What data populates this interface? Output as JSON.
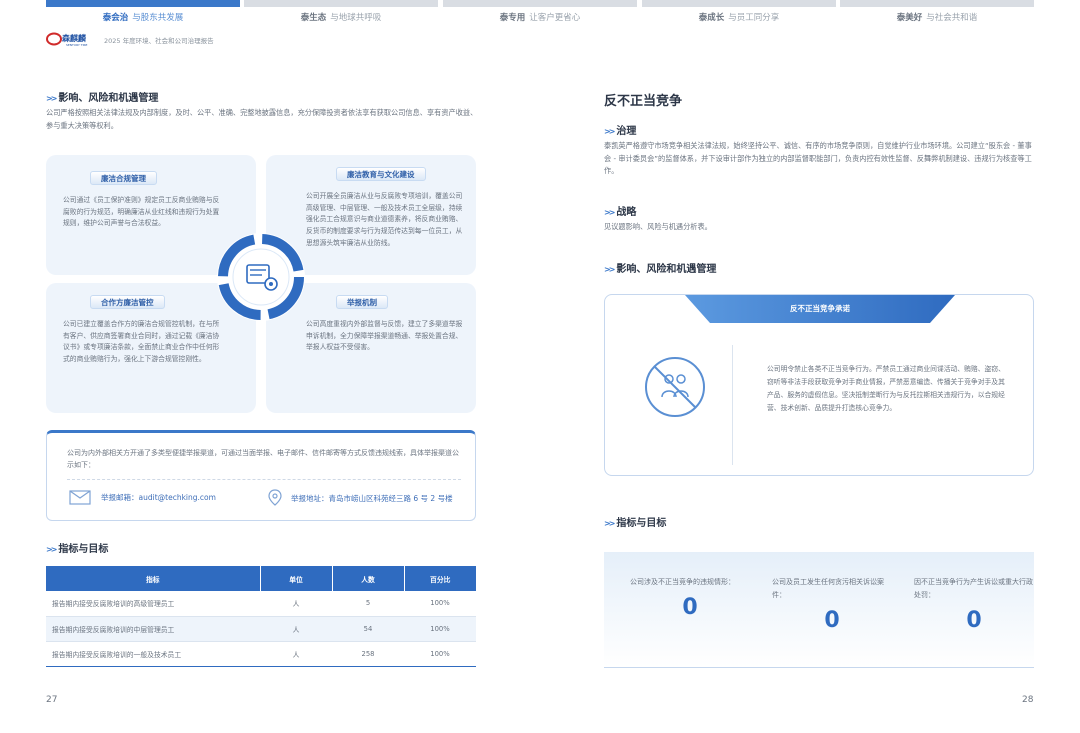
{
  "tabs": [
    {
      "key": "泰会治",
      "text": "与股东共发展",
      "active": true
    },
    {
      "key": "泰生态",
      "text": "与地球共呼吸",
      "active": false
    },
    {
      "key": "泰专用",
      "text": "让客户更省心",
      "active": false
    },
    {
      "key": "泰成长",
      "text": "与员工同分享",
      "active": false
    },
    {
      "key": "泰美好",
      "text": "与社会共和谐",
      "active": false
    }
  ],
  "brand": {
    "logo_text": "森麒麟轮胎",
    "logo_sub": "SENTURY TIRE",
    "report_title": "2025 年度环境、社会和公司治理报告"
  },
  "left": {
    "impact_heading": "影响、风险和机遇管理",
    "impact_text": "公司严格按照相关法律法规及内部制度，及时、公平、准确、完整地披露信息，充分保障投资者依法享有获取公司信息、享有资产收益、参与重大决策等权利。",
    "quadrants": [
      {
        "title": "廉洁合规管理",
        "text": "公司通过《员工保护准则》规定员工反商业贿赂与反腐败的行为规范，明确廉洁从业红线和违规行为处置规则，维护公司声誉与合法权益。"
      },
      {
        "title": "廉洁教育与文化建设",
        "text": "公司开展全员廉洁从业与反腐败专项培训，覆盖公司高级管理、中层管理、一般及技术员工全层级，持续强化员工合规意识与商业道德素养，将反商业贿赂、反货币的制度要求与行为规范传达到每一位员工，从思想源头筑牢廉洁从业防线。"
      },
      {
        "title": "合作方廉洁管控",
        "text": "公司已建立覆盖合作方的廉洁合规管控机制，在与所有客户、供应商签署商业合同时，通过记载《廉洁协议书》或专项廉洁条款，全面禁止商业合作中任何形式的商业贿赂行为，强化上下游合规管控刚性。"
      },
      {
        "title": "举报机制",
        "text": "公司高度重视内外部监督与反馈，建立了多渠道举报申诉机制，全力保障举报渠道畅通、举报处置合规、举报人权益不受侵害。"
      }
    ],
    "contact": {
      "text": "公司为内外部相关方开通了多类型便捷举报渠道，可通过当面举报、电子邮件、信件邮寄等方式反馈违规线索，具体举报渠道公示如下：",
      "email_label": "举报邮箱：audit@techking.com",
      "address_label": "举报地址：青岛市崂山区科苑经三路 6 号 2 号楼"
    },
    "metrics_heading": "指标与目标",
    "table": {
      "headers": [
        "指标",
        "单位",
        "人数",
        "百分比"
      ],
      "rows": [
        [
          "报告期内接受反腐败培训的高级管理员工",
          "人",
          "5",
          "100%"
        ],
        [
          "报告期内接受反腐败培训的中层管理员工",
          "人",
          "54",
          "100%"
        ],
        [
          "报告期内接受反腐败培训的一般及技术员工",
          "人",
          "258",
          "100%"
        ]
      ]
    },
    "page_number": "27"
  },
  "right": {
    "title": "反不正当竞争",
    "governance_heading": "治理",
    "governance_text": "泰凯英严格遵守市场竞争相关法律法规，始终坚持公平、诚信、有序的市场竞争原则，自觉维护行业市场环境。公司建立“股东会 - 董事会 - 审计委员会”的监督体系，并下设审计部作为独立的内部监督职能部门，负责内控有效性监督、反舞弊机制建设、违规行为核查等工作。",
    "strategy_heading": "战略",
    "strategy_text": "见议题影响、风险与机遇分析表。",
    "impact_heading": "影响、风险和机遇管理",
    "commitment": {
      "title": "反不正当竞争承诺",
      "text": "公司明令禁止各类不正当竞争行为。严禁员工通过商业间谍活动、贿赂、盗窃、窃听等非法手段获取竞争对手商业情报，严禁恶意编造、传播关于竞争对手及其产品、服务的虚假信息。坚决抵制垄断行为与反托拉斯相关违规行为，以合规经营、技术创新、品质提升打造核心竞争力。"
    },
    "metrics_heading": "指标与目标",
    "stats": [
      {
        "label": "公司涉及不正当竞争的违规情形：",
        "value": "0"
      },
      {
        "label": "公司及员工发生任何贪污相关诉讼案件：",
        "value": "0"
      },
      {
        "label": "因不正当竞争行为产生诉讼或重大行政处罚：",
        "value": "0"
      }
    ],
    "page_number": "28"
  },
  "colors": {
    "accent": "#2f6bc0",
    "accent_light": "#3b78c9",
    "panel": "#eef4fb"
  }
}
